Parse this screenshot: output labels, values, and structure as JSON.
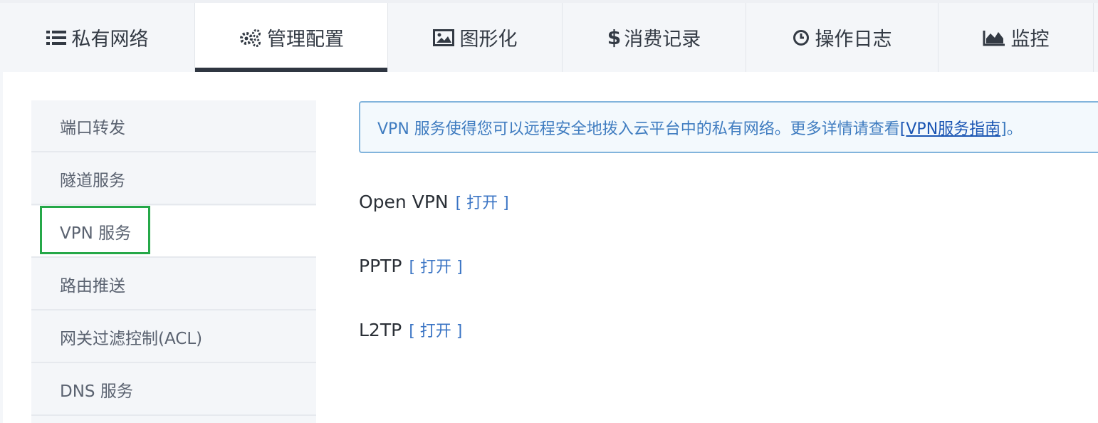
{
  "tabs": [
    {
      "label": "私有网络",
      "icon": "list-icon"
    },
    {
      "label": "管理配置",
      "icon": "gears-icon",
      "active": true
    },
    {
      "label": "图形化",
      "icon": "picture-icon"
    },
    {
      "label": "消费记录",
      "icon": "dollar-icon"
    },
    {
      "label": "操作日志",
      "icon": "clock-icon"
    },
    {
      "label": "监控",
      "icon": "area-chart-icon"
    }
  ],
  "sidebar": {
    "items": [
      {
        "label": "端口转发"
      },
      {
        "label": "隧道服务"
      },
      {
        "label": "VPN 服务",
        "active": true
      },
      {
        "label": "路由推送"
      },
      {
        "label": "网关过滤控制(ACL)"
      },
      {
        "label": "DNS 服务"
      }
    ]
  },
  "info": {
    "text": "VPN 服务使得您可以远程安全地拨入云平台中的私有网络。更多详情请查看",
    "link_open": "[",
    "link_text": "VPN服务指南",
    "link_close": "]。"
  },
  "services": [
    {
      "name": "Open VPN",
      "action": "[ 打开 ]"
    },
    {
      "name": "PPTP",
      "action": "[ 打开 ]"
    },
    {
      "name": "L2TP",
      "action": "[ 打开 ]"
    }
  ],
  "colors": {
    "accent": "#3a74c4",
    "highlight": "#25a848",
    "active_tab_bar": "#2f3641"
  }
}
